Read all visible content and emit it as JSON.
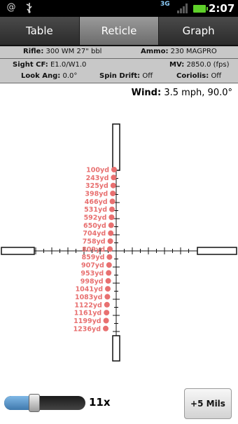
{
  "status_bar": {
    "notifications": [
      "@",
      "usb"
    ],
    "network": "3G",
    "time": "2:07"
  },
  "tabs": [
    {
      "label": "Table",
      "active": false
    },
    {
      "label": "Reticle",
      "active": true
    },
    {
      "label": "Graph",
      "active": false
    }
  ],
  "info": {
    "rifle_label": "Rifle:",
    "rifle_value": "300 WM 27\" bbl",
    "ammo_label": "Ammo:",
    "ammo_value": "230 MAGPRO",
    "sight_cf_label": "Sight CF:",
    "sight_cf_value": "E1.0/W1.0",
    "mv_label": "MV:",
    "mv_value": "2850.0 (fps)",
    "look_ang_label": "Look Ang:",
    "look_ang_value": "0.0°",
    "spin_drift_label": "Spin Drift:",
    "spin_drift_value": "Off",
    "coriolis_label": "Coriolis:",
    "coriolis_value": "Off"
  },
  "wind": {
    "label": "Wind:",
    "value": "3.5 mph, 90.0°"
  },
  "reticle": {
    "marker_color": "#e87070",
    "distances": [
      "100yd",
      "243yd",
      "325yd",
      "398yd",
      "466yd",
      "531yd",
      "592yd",
      "650yd",
      "704yd",
      "758yd",
      "809yd",
      "859yd",
      "907yd",
      "953yd",
      "998yd",
      "1041yd",
      "1083yd",
      "1122yd",
      "1161yd",
      "1199yd",
      "1236yd"
    ]
  },
  "zoom": {
    "value": 0.35,
    "label": "11x"
  },
  "mils_button": {
    "label": "+5 Mils"
  }
}
